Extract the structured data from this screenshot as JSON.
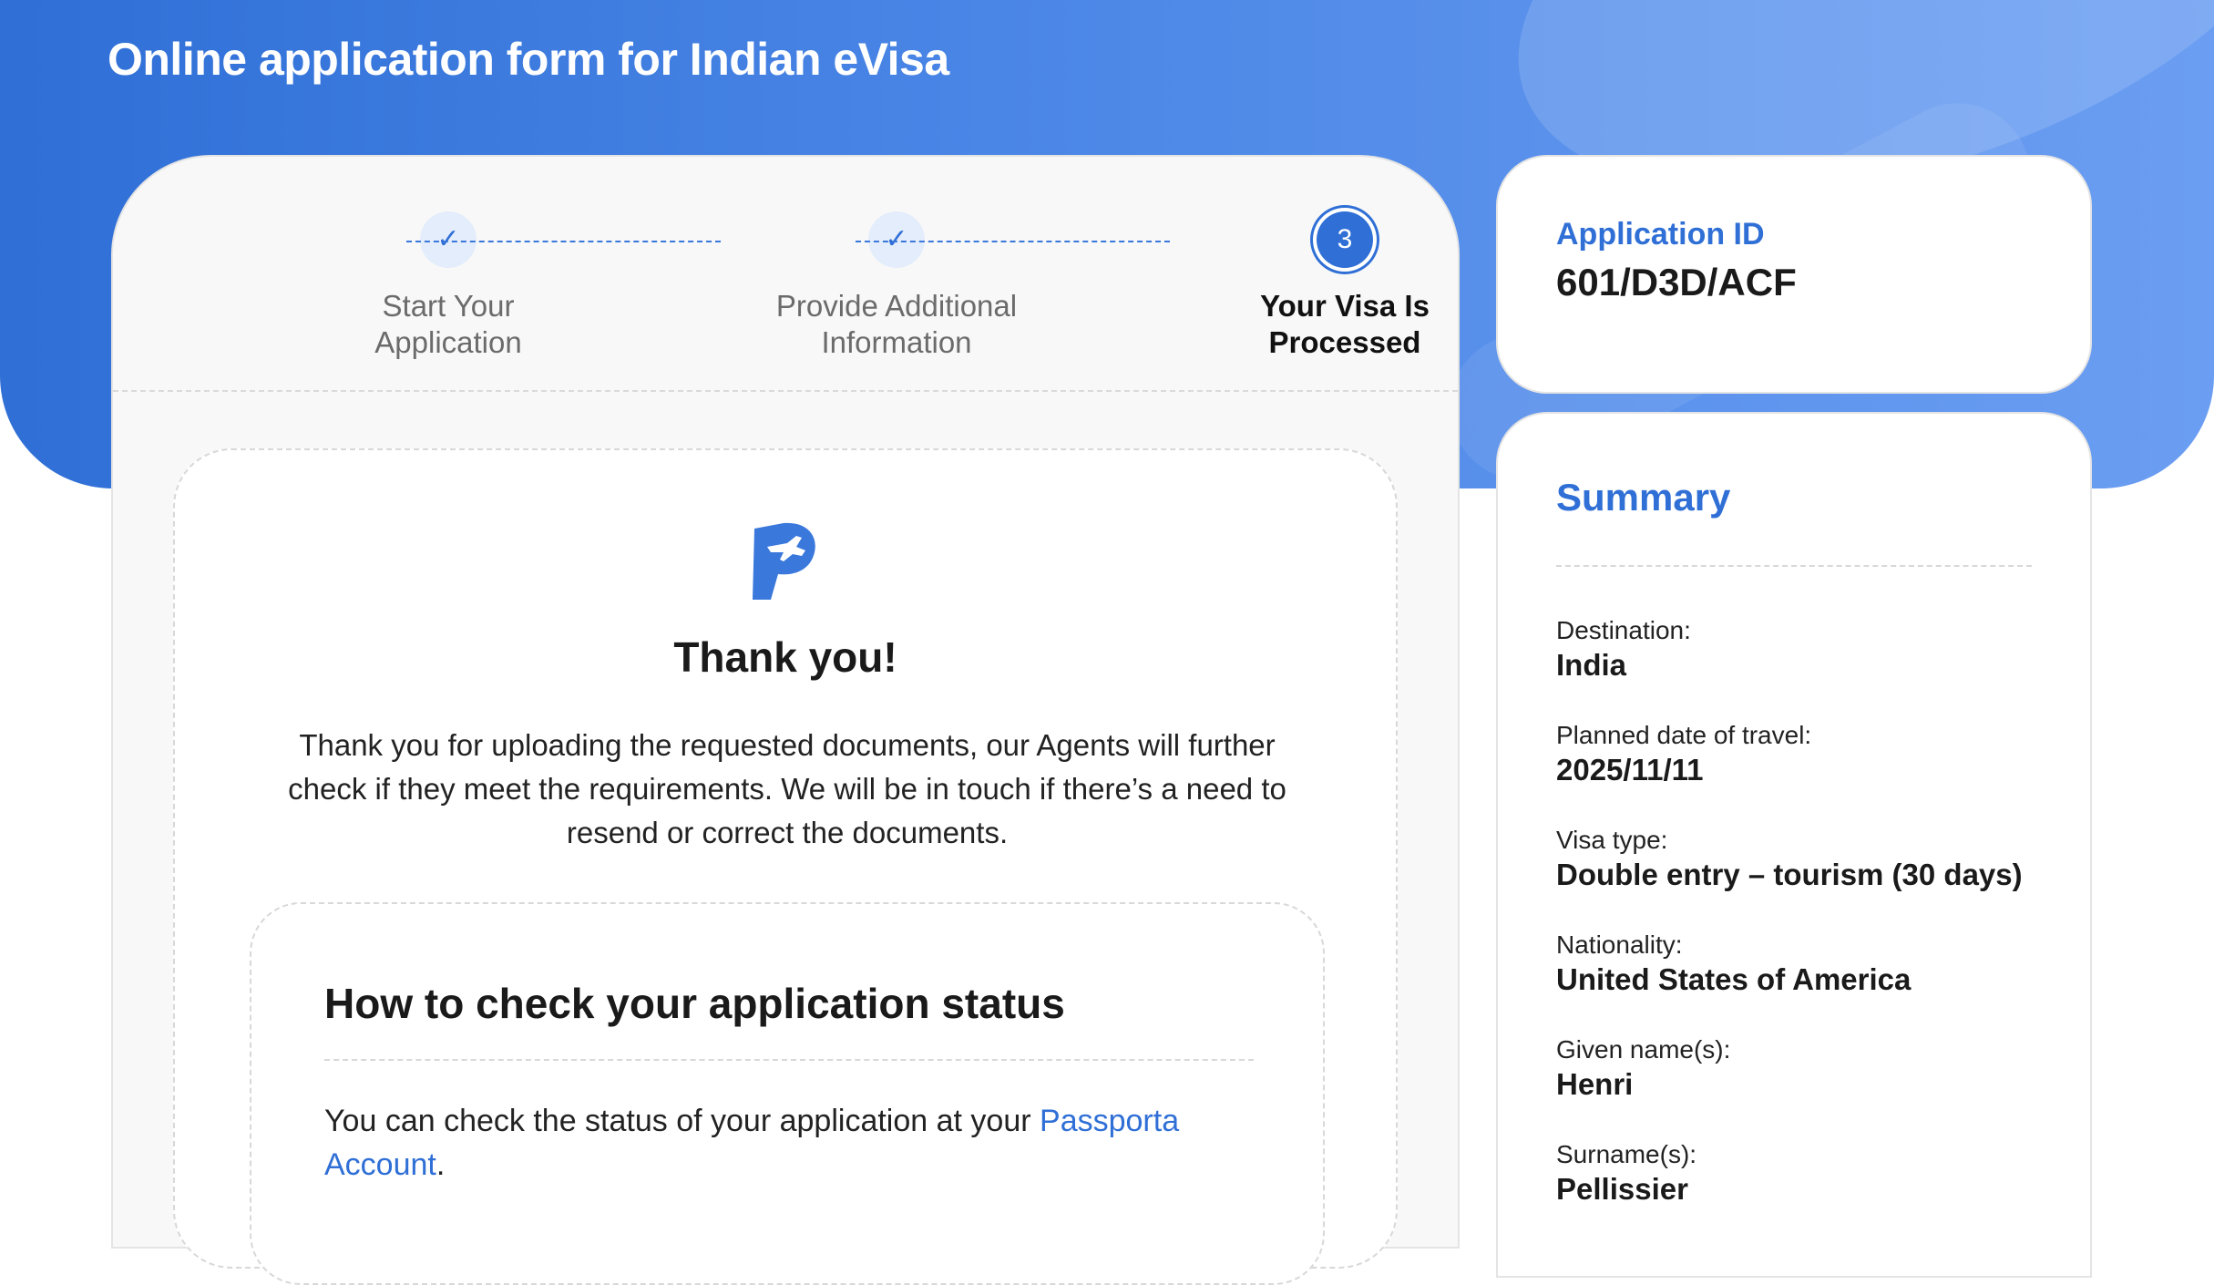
{
  "header": {
    "title": "Online application form for Indian eVisa"
  },
  "stepper": {
    "steps": [
      {
        "label": "Start Your Application",
        "marker": "✓"
      },
      {
        "label": "Provide Additional Information",
        "marker": "✓"
      },
      {
        "label": "Your Visa Is Processed",
        "marker": "3"
      }
    ]
  },
  "thanks": {
    "title": "Thank you!",
    "message": "Thank you for uploading the requested documents, our Agents will further check if they meet the requirements. We will be in touch if there’s a need to resend or correct the documents."
  },
  "status": {
    "title": "How to check your application status",
    "text_prefix": "You can check the status of your application at your ",
    "link_text": "Passporta Account",
    "text_suffix": "."
  },
  "application": {
    "label": "Application ID",
    "value": "601/D3D/ACF"
  },
  "summary": {
    "title": "Summary",
    "items": [
      {
        "key": "Destination:",
        "value": "India"
      },
      {
        "key": "Planned date of travel:",
        "value": "2025/11/11"
      },
      {
        "key": "Visa type:",
        "value": "Double entry – tourism (30 days)"
      },
      {
        "key": "Nationality:",
        "value": "United States of America"
      },
      {
        "key": "Given name(s):",
        "value": "Henri"
      },
      {
        "key": "Surname(s):",
        "value": "Pellissier"
      }
    ]
  },
  "colors": {
    "accent": "#2f6fd6",
    "hero_start": "#2f6fd6",
    "hero_end": "#6b9ef2"
  }
}
